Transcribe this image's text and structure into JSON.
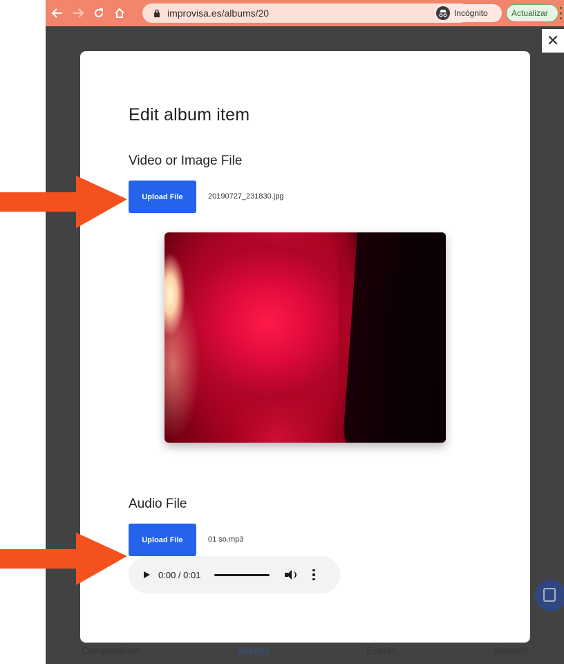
{
  "browser": {
    "url": "improvisa.es/albums/20",
    "incognito_label": "Incógnito",
    "update_label": "Actualizar",
    "accent_color": "#f2856b"
  },
  "modal": {
    "close_symbol": "✕",
    "title": "Edit album item",
    "media_section": {
      "title": "Video or Image File",
      "upload_label": "Upload File",
      "file_name": "20190727_231830.jpg"
    },
    "audio_section": {
      "title": "Audio File",
      "upload_label": "Upload File",
      "file_name": "01 so.mp3",
      "player_time": "0:00 / 0:01"
    }
  },
  "bottom_nav": {
    "items": [
      "Compositions",
      "Albums",
      "Events",
      "Account"
    ],
    "active": "Albums"
  },
  "colors": {
    "primary_button": "#2563eb",
    "annotation_arrow": "#f4511e"
  }
}
